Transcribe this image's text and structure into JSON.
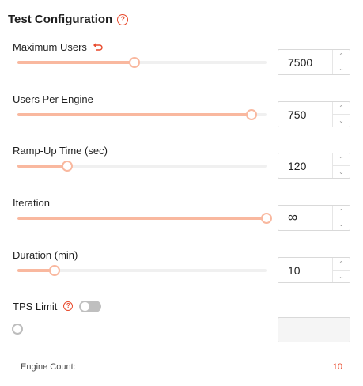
{
  "header": {
    "title": "Test Configuration"
  },
  "fields": [
    {
      "label": "Maximum Users",
      "value": "7500",
      "level_percent": 47
    },
    {
      "label": "Users Per Engine",
      "value": "750",
      "level_percent": 94
    },
    {
      "label": "Ramp-Up Time (sec)",
      "value": "120",
      "level_percent": 20
    },
    {
      "label": "Iteration",
      "value": "∞",
      "level_percent": 100
    },
    {
      "label": "Duration (min)",
      "value": "10",
      "level_percent": 15
    },
    {
      "label": "TPS Limit",
      "value": "",
      "level_percent": 0,
      "enabled": false
    }
  ],
  "footer": {
    "label": "Engine Count:",
    "value": "10"
  },
  "colors": {
    "accent": "#e8492b",
    "slider_fill": "#f9b89f",
    "track": "#f0f0f0",
    "toggle_off": "#bfbfbf"
  }
}
